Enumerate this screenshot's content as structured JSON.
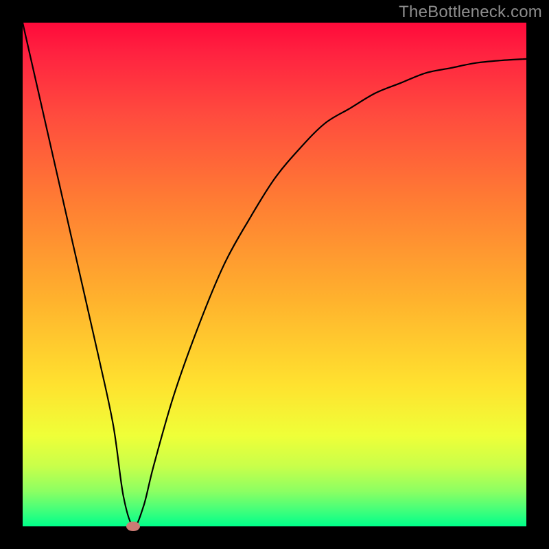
{
  "watermark": "TheBottleneck.com",
  "chart_data": {
    "type": "line",
    "title": "",
    "xlabel": "",
    "ylabel": "",
    "xlim": [
      0,
      100
    ],
    "ylim": [
      0,
      100
    ],
    "grid": false,
    "series": [
      {
        "name": "curve",
        "x": [
          0,
          5,
          10,
          15,
          18,
          20,
          22,
          24,
          26,
          30,
          35,
          40,
          45,
          50,
          55,
          60,
          65,
          70,
          75,
          80,
          85,
          90,
          95,
          100
        ],
        "y": [
          100,
          78,
          56,
          34,
          20,
          6,
          0,
          4,
          12,
          26,
          40,
          52,
          61,
          69,
          75,
          80,
          83,
          86,
          88,
          90,
          91,
          92,
          92.5,
          92.8
        ]
      }
    ],
    "marker": {
      "x": 22,
      "y": 0,
      "color": "#cc7b74"
    },
    "gradient_stops": [
      {
        "pos": 0,
        "color": "#ff0a3a"
      },
      {
        "pos": 18,
        "color": "#ff4a3e"
      },
      {
        "pos": 55,
        "color": "#ffb22d"
      },
      {
        "pos": 82,
        "color": "#efff38"
      },
      {
        "pos": 100,
        "color": "#00ff8a"
      }
    ]
  }
}
